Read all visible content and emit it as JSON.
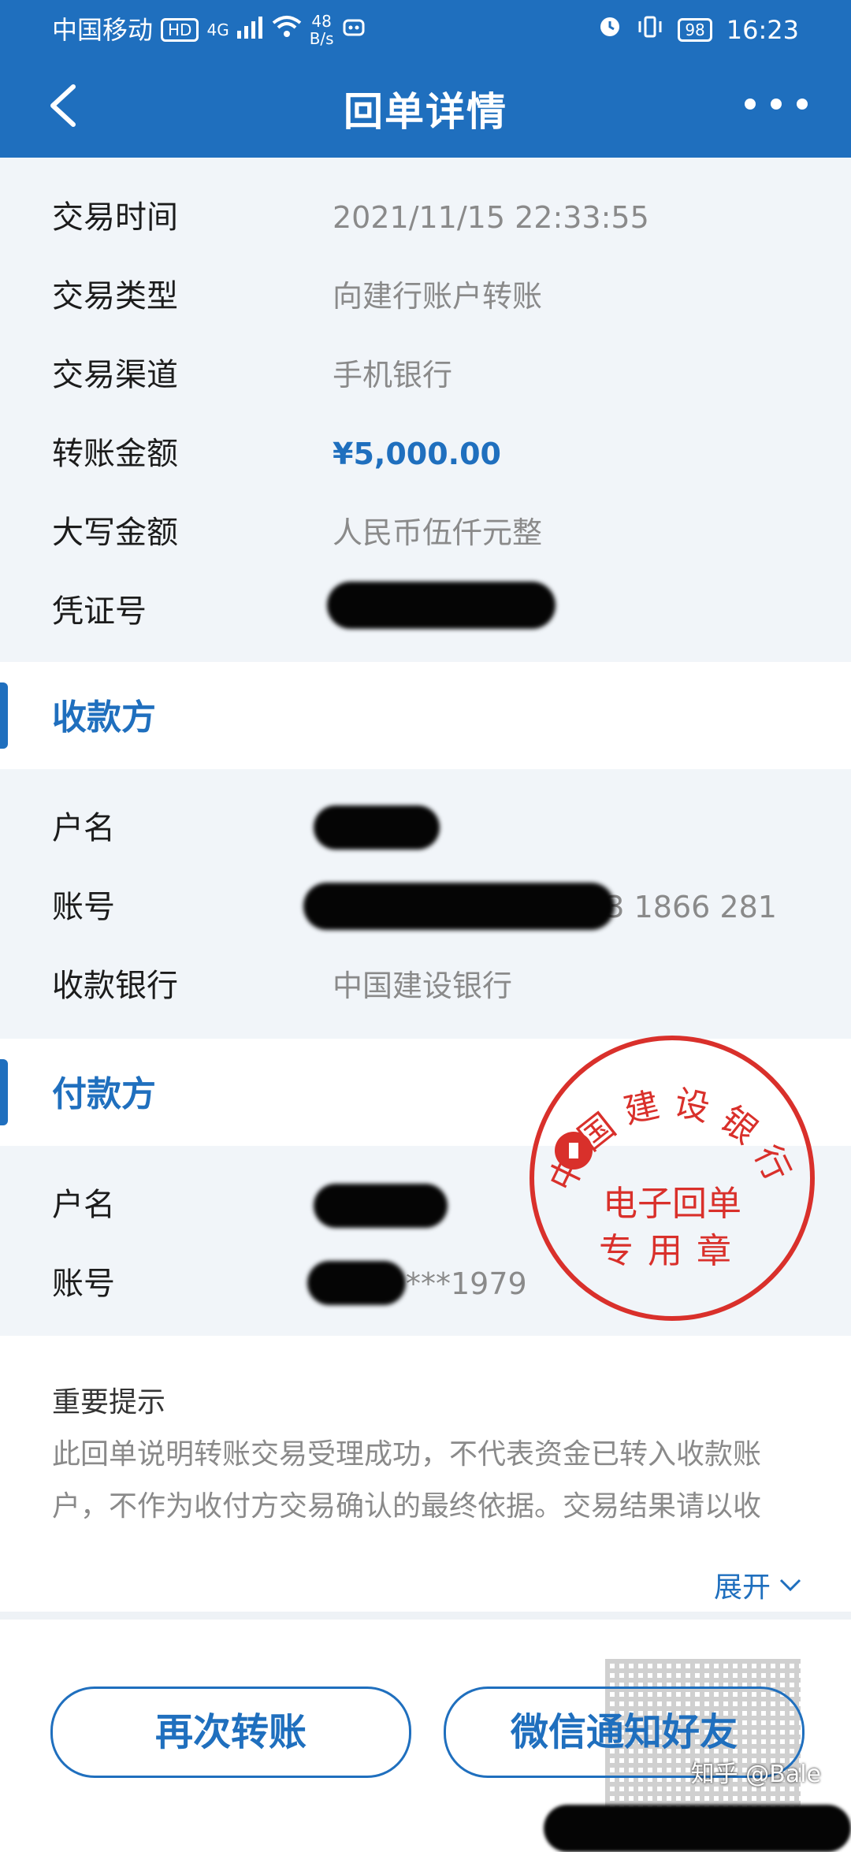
{
  "status_bar": {
    "carrier": "中国移动",
    "hd": "HD",
    "signal_label": "4G",
    "speed_value": "48",
    "speed_unit": "B/s",
    "battery": "98",
    "time": "16:23"
  },
  "header": {
    "title": "回单详情"
  },
  "details": [
    {
      "label": "交易时间",
      "value": "2021/11/15  22:33:55"
    },
    {
      "label": "交易类型",
      "value": "向建行账户转账"
    },
    {
      "label": "交易渠道",
      "value": "手机银行"
    },
    {
      "label": "转账金额",
      "value": "¥5,000.00"
    },
    {
      "label": "大写金额",
      "value": "人民币伍仟元整"
    },
    {
      "label": "凭证号",
      "value": ""
    }
  ],
  "payee": {
    "section_title": "收款方",
    "rows": [
      {
        "label": "户名",
        "value": ""
      },
      {
        "label": "账号",
        "value": "003 1866 281"
      },
      {
        "label": "收款银行",
        "value": "中国建设银行"
      }
    ]
  },
  "payer": {
    "section_title": "付款方",
    "rows": [
      {
        "label": "户名",
        "value": ""
      },
      {
        "label": "账号",
        "value": "***1979"
      }
    ]
  },
  "seal": {
    "bank_name": "中国建设银行",
    "line1": "电子回单",
    "line2": "专用章"
  },
  "notice": {
    "title": "重要提示",
    "text": "此回单说明转账交易受理成功，不代表资金已转入收款账户，不作为收付方交易确认的最终依据。交易结果请以收",
    "expand_label": "展开"
  },
  "actions": {
    "again_label": "再次转账",
    "wechat_label": "微信通知好友"
  },
  "watermark": "知乎 @Bale",
  "colors": {
    "primary": "#1f6fbe",
    "seal": "#d9302b"
  }
}
